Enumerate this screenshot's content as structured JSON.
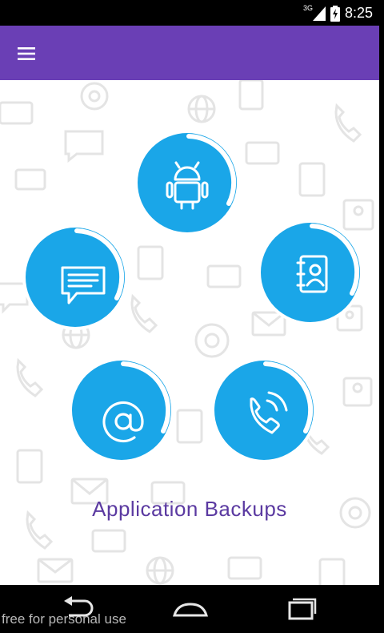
{
  "status_bar": {
    "network": "3G",
    "time": "8:25"
  },
  "app_bar": {
    "menu_icon": "hamburger-menu-icon",
    "color": "#6a3fb5"
  },
  "backup_options": [
    {
      "id": "apps",
      "icon": "android-icon"
    },
    {
      "id": "sms",
      "icon": "message-icon"
    },
    {
      "id": "contacts",
      "icon": "contacts-book-icon"
    },
    {
      "id": "email",
      "icon": "at-sign-icon"
    },
    {
      "id": "calls",
      "icon": "phone-call-icon"
    }
  ],
  "title": "Application Backups",
  "accent_color": "#1aa6e8",
  "watermark": "free for personal use",
  "nav": {
    "back": "back-icon",
    "home": "home-icon",
    "recents": "recents-icon"
  }
}
